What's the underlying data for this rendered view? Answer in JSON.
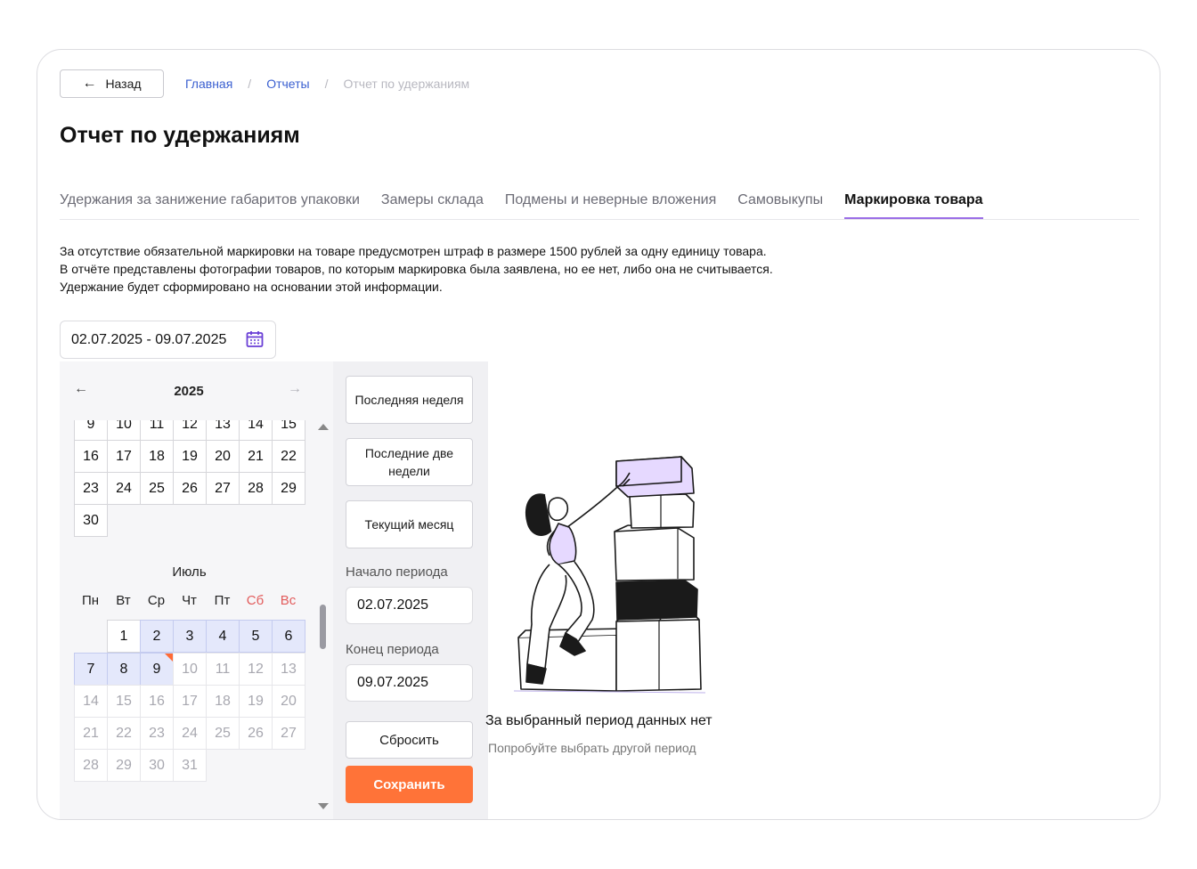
{
  "header": {
    "back_label": "Назад",
    "breadcrumb": [
      "Главная",
      "Отчеты",
      "Отчет по удержаниям"
    ],
    "breadcrumb_sep": "/",
    "title": "Отчет по удержаниям"
  },
  "tabs": [
    {
      "label": "Удержания за занижение габаритов упаковки",
      "active": false
    },
    {
      "label": "Замеры склада",
      "active": false
    },
    {
      "label": "Подмены и неверные вложения",
      "active": false
    },
    {
      "label": "Самовыкупы",
      "active": false
    },
    {
      "label": "Маркировка товара",
      "active": true
    }
  ],
  "info_lines": [
    "За отсутствие обязательной маркировки на товаре предусмотрен штраф в размере 1500 рублей за одну единицу товара.",
    "В отчёте представлены фотографии товаров, по которым маркировка была заявлена, но ее нет, либо она не считывается.",
    "Удержание будет сформировано на основании этой информации."
  ],
  "date_range": "02.07.2025 - 09.07.2025",
  "calendar": {
    "year": "2025",
    "june_partial": {
      "weeks": [
        [
          "9",
          "10",
          "11",
          "12",
          "13",
          "14",
          "15"
        ],
        [
          "16",
          "17",
          "18",
          "19",
          "20",
          "21",
          "22"
        ],
        [
          "23",
          "24",
          "25",
          "26",
          "27",
          "28",
          "29"
        ],
        [
          "30",
          "",
          "",
          "",
          "",
          "",
          ""
        ]
      ]
    },
    "july": {
      "label": "Июль",
      "weekdays": [
        "Пн",
        "Вт",
        "Ср",
        "Чт",
        "Пт",
        "Сб",
        "Вс"
      ],
      "weeks": [
        [
          "",
          "1",
          "2",
          "3",
          "4",
          "5",
          "6"
        ],
        [
          "7",
          "8",
          "9",
          "10",
          "11",
          "12",
          "13"
        ],
        [
          "14",
          "15",
          "16",
          "17",
          "18",
          "19",
          "20"
        ],
        [
          "21",
          "22",
          "23",
          "24",
          "25",
          "26",
          "27"
        ],
        [
          "28",
          "29",
          "30",
          "31",
          "",
          "",
          ""
        ]
      ],
      "selected": [
        "2",
        "3",
        "4",
        "5",
        "6",
        "7",
        "8",
        "9"
      ],
      "enabled": [
        "1",
        "2",
        "3",
        "4",
        "5",
        "6",
        "7",
        "8",
        "9"
      ],
      "today": "9"
    }
  },
  "options": {
    "last_week": "Последняя неделя",
    "last_two_weeks": "Последние две недели",
    "current_month": "Текущий месяц",
    "start_label": "Начало периода",
    "start_value": "02.07.2025",
    "end_label": "Конец периода",
    "end_value": "09.07.2025",
    "reset": "Сбросить",
    "save": "Сохранить"
  },
  "empty": {
    "title": "За выбранный период данных нет",
    "subtitle": "Попробуйте выбрать другой период"
  },
  "colors": {
    "accent": "#ff7338",
    "tab_underline": "#9b6ee6",
    "link": "#3a5fd0",
    "selected_day": "#e4e8fb",
    "weekend": "#e25c5c",
    "box_purple": "#e6d9ff"
  }
}
